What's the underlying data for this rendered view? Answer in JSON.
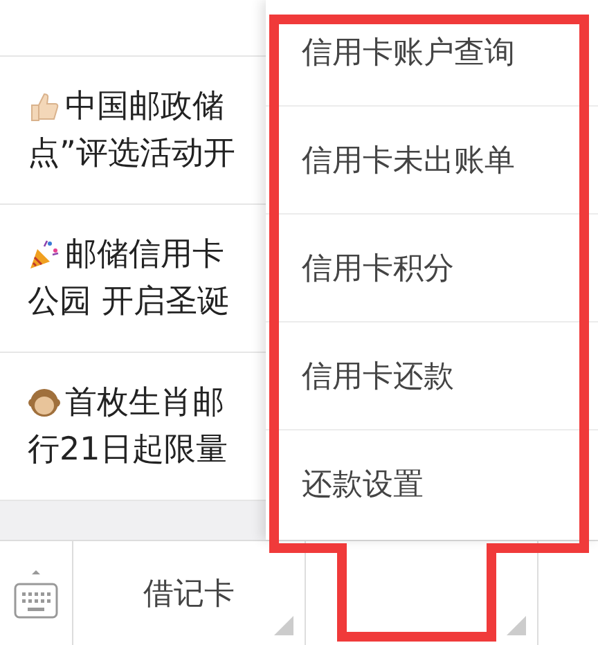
{
  "articles": [
    {
      "kind": "thumbs_up",
      "lines": [
        "中国邮政储",
        "点”评选活动开"
      ]
    },
    {
      "kind": "party_popper",
      "lines": [
        "邮储信用卡",
        "公园 开启圣诞"
      ]
    },
    {
      "kind": "monkey",
      "lines": [
        "首枚生肖邮",
        "行21日起限量"
      ]
    }
  ],
  "menu": {
    "items": [
      "信用卡账户查询",
      "信用卡未出账单",
      "信用卡积分",
      "信用卡还款",
      "还款设置"
    ]
  },
  "bottom_bar": {
    "tabs": [
      {
        "label": "借记卡",
        "submenu": true
      },
      {
        "submenu": true
      }
    ]
  },
  "annotation": {
    "kind": "highlight_frame"
  }
}
